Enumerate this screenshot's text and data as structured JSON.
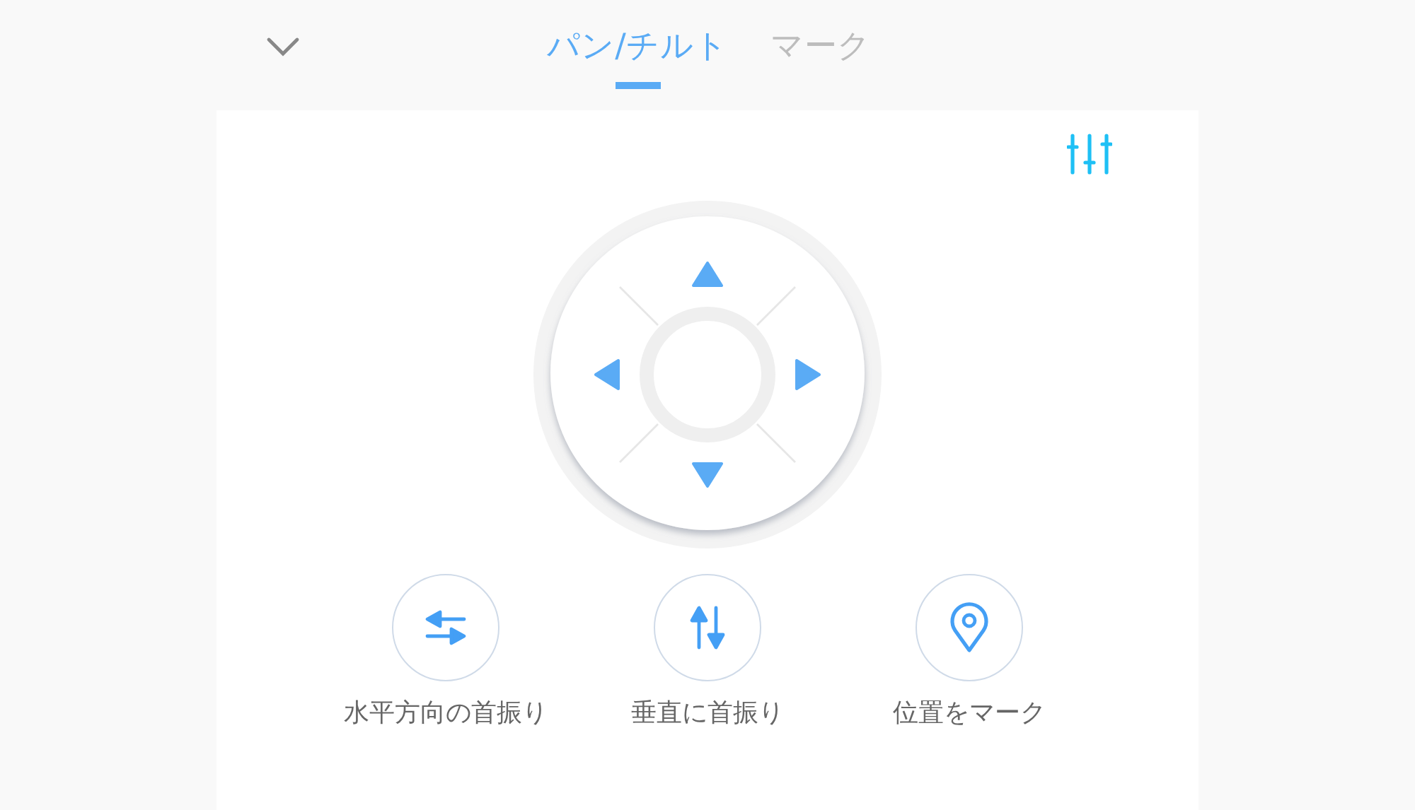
{
  "tabs": [
    {
      "label": "パン/チルト",
      "selected": true
    },
    {
      "label": "マーク",
      "selected": false
    }
  ],
  "actions": [
    {
      "kind": "swap-horizontal",
      "label": "水平方向の首振り"
    },
    {
      "kind": "swap-vertical",
      "label": "垂直に首振り"
    },
    {
      "kind": "pin",
      "label": "位置をマーク"
    }
  ]
}
